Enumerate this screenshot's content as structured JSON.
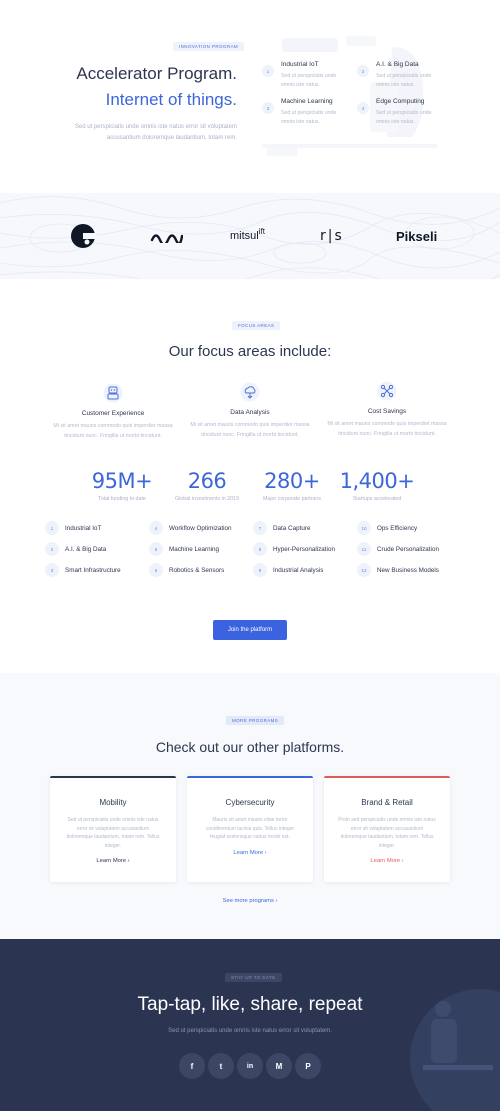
{
  "hero": {
    "tag": "INNOVATION PROGRAM",
    "title_line1": "Accelerator Program.",
    "title_line2": "Internet of things.",
    "subtitle": "Sed ut perspiciatis unde omnis iste natus error sit voluptatem accusantium doloremque laudantium, totam rem.",
    "features": [
      {
        "num": "1",
        "title": "Industrial IoT",
        "desc": "Sed ut perspiciatis unde omnis iste natus."
      },
      {
        "num": "2",
        "title": "A.I. & Big Data",
        "desc": "Sed ut perspiciatis unde omnis iste natus."
      },
      {
        "num": "3",
        "title": "Machine Learning",
        "desc": "Sed ut perspiciatis unde omnis iste natus."
      },
      {
        "num": "4",
        "title": "Edge Computing",
        "desc": "Sed ut perspiciatis unde omnis iste natus."
      }
    ]
  },
  "logos": [
    {
      "name": "c-logo-icon",
      "text": ""
    },
    {
      "name": "wave-logo-icon",
      "text": ""
    },
    {
      "name": "mitsulift-logo",
      "text": "mitsul",
      "sup": "ift"
    },
    {
      "name": "rs-logo",
      "text": "r|s"
    },
    {
      "name": "pikseli-logo",
      "text": "Pikseli"
    }
  ],
  "focus": {
    "tag": "FOCUS AREAS",
    "title": "Our focus areas include:",
    "columns": [
      {
        "icon": "robot-icon",
        "title": "Customer Experience",
        "desc": "Mi sit amet mauris commodo quis imperdiet massa tincidunt nunc. Fringilla ut morbi tincidunt."
      },
      {
        "icon": "data-cloud-icon",
        "title": "Data Analysis",
        "desc": "Mi sit amet mauris commodo quis imperdiet massa tincidunt nunc. Fringilla ut morbi tincidunt."
      },
      {
        "icon": "network-icon",
        "title": "Cost Savings",
        "desc": "Mi sit amet mauris commodo quis imperdiet massa tincidunt nunc. Fringilla ut morbi tincidunt."
      }
    ],
    "stats": [
      {
        "value": "95M+",
        "label": "Total funding to date"
      },
      {
        "value": "266",
        "label": "Global investments in 2019"
      },
      {
        "value": "280+",
        "label": "Major corporate partners"
      },
      {
        "value": "1,400+",
        "label": "Startups accelerated"
      }
    ],
    "items": [
      {
        "num": "1",
        "label": "Industrial IoT"
      },
      {
        "num": "2",
        "label": "A.I. & Big Data"
      },
      {
        "num": "3",
        "label": "Smart Infrastructure"
      },
      {
        "num": "4",
        "label": "Workflow Optimization"
      },
      {
        "num": "5",
        "label": "Machine Learning"
      },
      {
        "num": "6",
        "label": "Robotics & Sensors"
      },
      {
        "num": "7",
        "label": "Data Capture"
      },
      {
        "num": "8",
        "label": "Hyper-Personalization"
      },
      {
        "num": "9",
        "label": "Industrial Analysis"
      },
      {
        "num": "10",
        "label": "Ops Efficiency"
      },
      {
        "num": "11",
        "label": "Crude Personalization"
      },
      {
        "num": "12",
        "label": "New Business Models"
      }
    ],
    "button": "Join the platform"
  },
  "platforms": {
    "tag": "MORE PROGRAMS",
    "title": "Check out our other platforms.",
    "cards": [
      {
        "title": "Mobility",
        "desc": "Sed ut perspiciatis unde omnis iste natus error sit voluptatem accusantium doloremque laudantium, totam rem. Tellus integer.",
        "more": "Learn More  ›",
        "accent": "#2c3650"
      },
      {
        "title": "Cybersecurity",
        "desc": "Mauris sit amet mauris vitae tortor condimentum lacinia quis. Tellus integer feugiat scelerisque varius morbi est.",
        "more": "Learn More  ›",
        "accent": "#3d66d9"
      },
      {
        "title": "Brand & Retail",
        "desc": "Proin sed perspiciatis unde omnis iste natus error sit voluptatem accusantium doloremque laudantium, totam rem. Tellus integer.",
        "more": "Learn More  ›",
        "accent": "#e35a5a"
      }
    ],
    "see_more": "See more programs  ›"
  },
  "footer": {
    "tag": "STAY UP TO DATE",
    "title": "Tap-tap, like, share, repeat",
    "subtitle": "Sed ut perspiciatis unde omnis iste natus error sit voluptatem.",
    "social": [
      {
        "icon": "facebook-icon",
        "glyph": "f"
      },
      {
        "icon": "twitter-icon",
        "glyph": "t"
      },
      {
        "icon": "linkedin-icon",
        "glyph": "in"
      },
      {
        "icon": "medium-icon",
        "glyph": "M"
      },
      {
        "icon": "pinterest-icon",
        "glyph": "P"
      }
    ]
  },
  "colors": {
    "accent": "#3d66d9",
    "dark": "#2c3650",
    "footer": "#2b3552"
  }
}
